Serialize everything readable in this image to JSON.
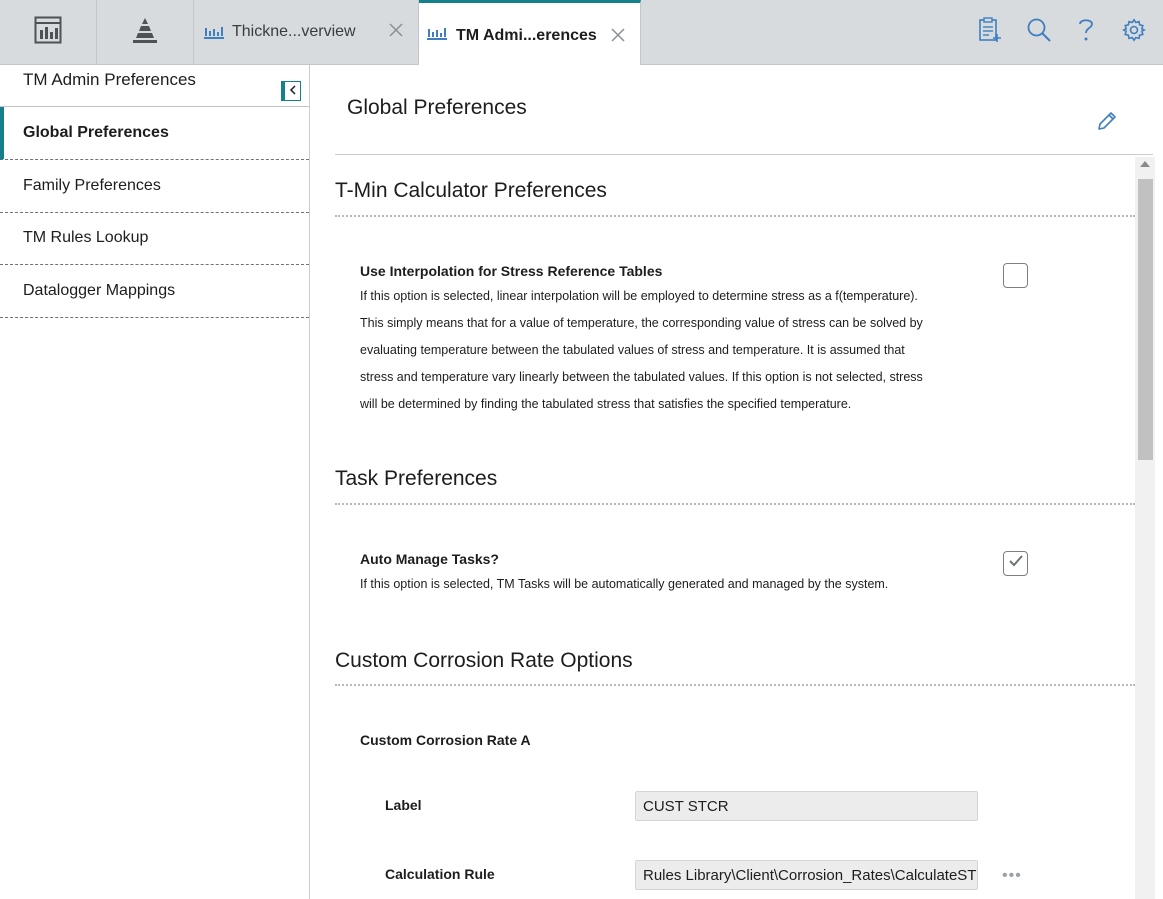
{
  "tabs": [
    {
      "label": "Thickne...verview",
      "icon": "chart-icon",
      "active": false
    },
    {
      "label": "TM Admi...erences",
      "icon": "chart-icon",
      "active": true
    }
  ],
  "accent_color": "#14808c",
  "sidebar": {
    "title": "TM Admin Preferences",
    "items": [
      {
        "label": "Global Preferences",
        "active": true
      },
      {
        "label": "Family Preferences",
        "active": false
      },
      {
        "label": "TM Rules Lookup",
        "active": false
      },
      {
        "label": "Datalogger Mappings",
        "active": false
      }
    ]
  },
  "main": {
    "title": "Global Preferences",
    "sections": {
      "tmin": {
        "title": "T-Min Calculator Preferences",
        "pref_title": "Use Interpolation for Stress Reference Tables",
        "desc_lines": [
          "If this option is selected, linear interpolation will be employed to determine stress as a f(temperature).",
          "This simply means that for a value of temperature, the corresponding value of stress can be solved by",
          "evaluating temperature between the tabulated values of stress and temperature. It is assumed that",
          "stress and temperature vary linearly between the tabulated values. If this option is not selected, stress",
          "will be determined by finding the tabulated stress that satisfies the specified temperature."
        ],
        "checked": false
      },
      "task": {
        "title": "Task Preferences",
        "pref_title": "Auto Manage Tasks?",
        "desc": "If this option is selected, TM Tasks will be automatically generated and managed by the system.",
        "checked": true
      },
      "corrosion": {
        "title": "Custom Corrosion Rate Options",
        "subtitle": "Custom Corrosion Rate A",
        "label_field": {
          "label": "Label",
          "value": "CUST STCR"
        },
        "rule_field": {
          "label": "Calculation Rule",
          "value": "Rules Library\\Client\\Corrosion_Rates\\CalculateSTCR"
        },
        "more_label": "•••"
      }
    }
  }
}
